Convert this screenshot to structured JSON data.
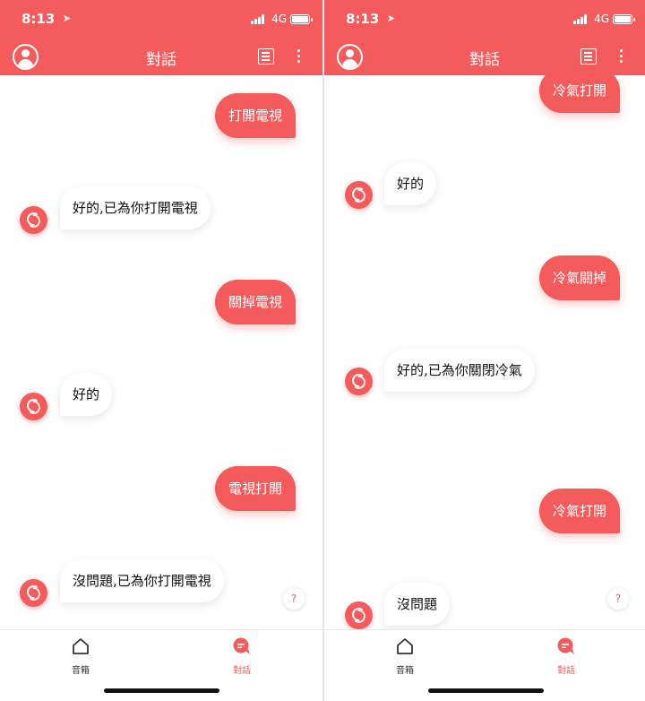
{
  "colors": {
    "accent": "#f35b5c",
    "text": "#111111"
  },
  "status_bar": {
    "time": "8:13",
    "network": "4G"
  },
  "header": {
    "title": "對話"
  },
  "tabs": {
    "speaker": "音箱",
    "dialog": "對話"
  },
  "help_label": "?",
  "left_chat": {
    "u1": "打開電視",
    "b1": "好的,已為你打開電視",
    "u2": "關掉電視",
    "b2": "好的",
    "u3": "電視打開",
    "b3": "沒問題,已為你打開電視"
  },
  "right_chat": {
    "u0": "冷氣打開",
    "b1": "好的",
    "u1": "冷氣關掉",
    "b2": "好的,已為你關閉冷氣",
    "u2": "冷氣打開",
    "b3": "沒問題"
  }
}
